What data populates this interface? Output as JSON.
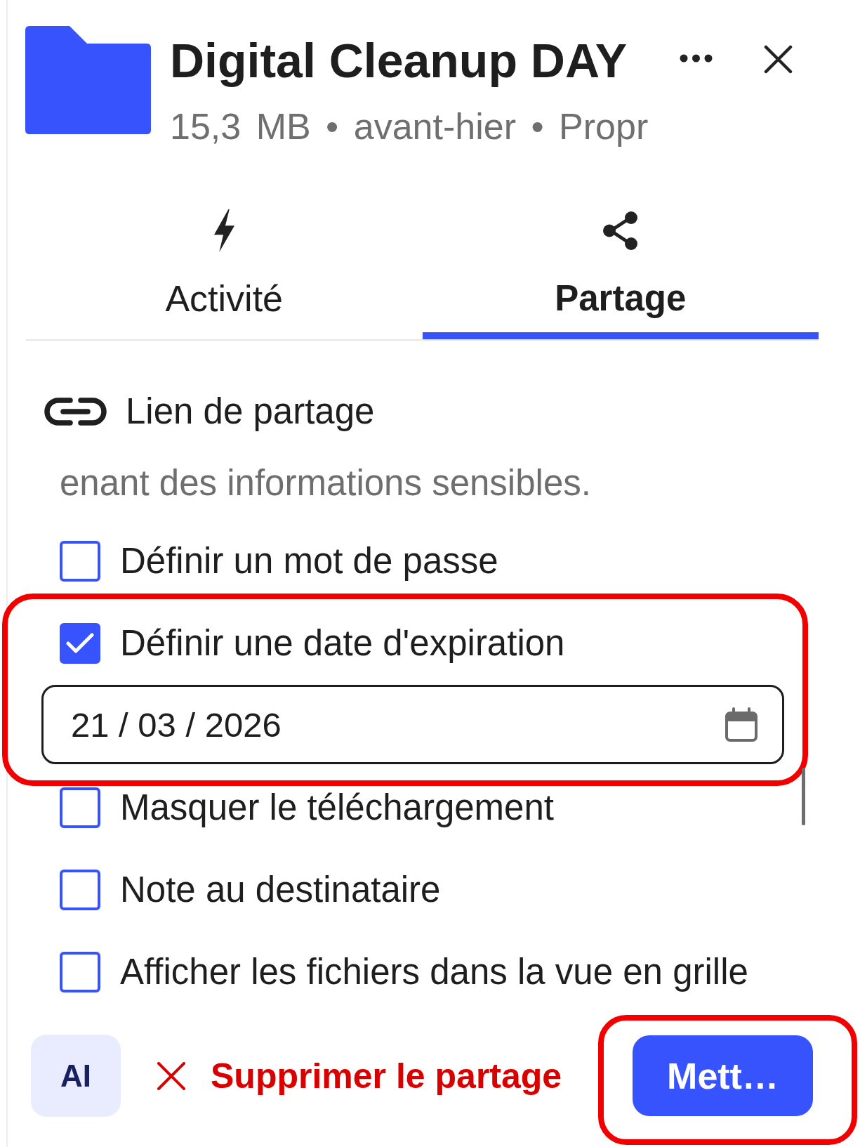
{
  "header": {
    "title": "Digital Cleanup DAY",
    "meta": "15,3 MB • avant-hier • Propr"
  },
  "tabs": [
    {
      "kind": "activity",
      "label": "Activité",
      "selected": false
    },
    {
      "kind": "sharing",
      "label": "Partage",
      "selected": true
    }
  ],
  "share_link": {
    "heading": "Lien de partage",
    "note": "enant des informations sensibles.",
    "options": [
      {
        "label": "Définir un mot de passe",
        "checked": false,
        "highlighted": false
      },
      {
        "label": "Définir une date d'expiration",
        "checked": true,
        "highlighted": true,
        "date_field": {
          "value": "21 / 03 / 2026"
        }
      },
      {
        "label": "Masquer le téléchargement",
        "checked": false,
        "highlighted": false
      },
      {
        "label": "Note au destinataire",
        "checked": false,
        "highlighted": false
      },
      {
        "label": "Afficher les fichiers dans la vue en grille",
        "checked": false,
        "highlighted": false
      }
    ]
  },
  "footer": {
    "ai_button": "AI",
    "delete_button": "Supprimer le partage",
    "primary_button": {
      "label": "Mett…",
      "highlighted": true
    }
  }
}
